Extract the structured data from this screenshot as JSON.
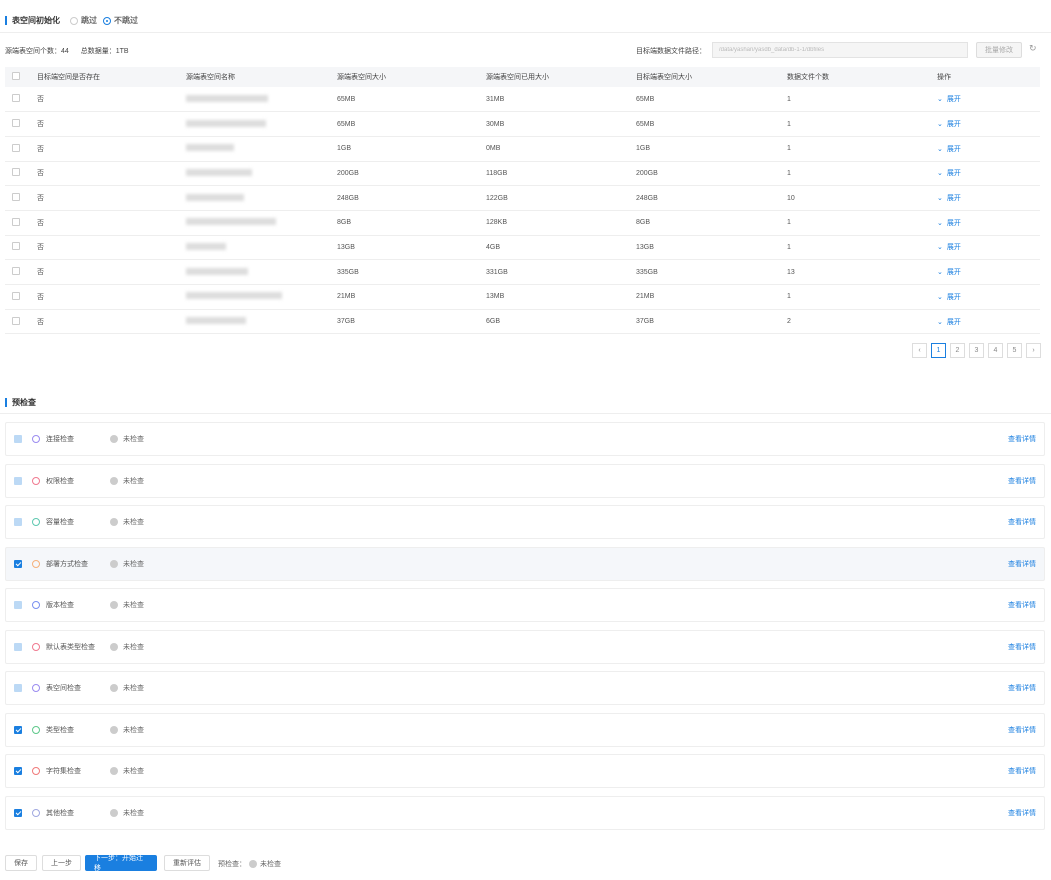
{
  "init": {
    "title": "表空间初始化",
    "opt_skip": "跳过",
    "opt_noskip": "不跳过"
  },
  "stats": {
    "count_label": "源端表空间个数：",
    "count": "44",
    "total_label": "总数据量：",
    "total": "1TB"
  },
  "path": {
    "label": "目标端数据文件路径：",
    "value": "/data/yashan/yasdb_data/db-1-1/dbfiles",
    "reset": "批量修改"
  },
  "table": {
    "headers": [
      "目标端空间是否存在",
      "源端表空间名称",
      "源端表空间大小",
      "源端表空间已用大小",
      "目标端表空间大小",
      "数据文件个数",
      "操作"
    ],
    "rows": [
      [
        "否",
        "65MB",
        "31MB",
        "65MB",
        "1"
      ],
      [
        "否",
        "65MB",
        "30MB",
        "65MB",
        "1"
      ],
      [
        "否",
        "1GB",
        "0MB",
        "1GB",
        "1"
      ],
      [
        "否",
        "200GB",
        "118GB",
        "200GB",
        "1"
      ],
      [
        "否",
        "248GB",
        "122GB",
        "248GB",
        "10"
      ],
      [
        "否",
        "8GB",
        "128KB",
        "8GB",
        "1"
      ],
      [
        "否",
        "13GB",
        "4GB",
        "13GB",
        "1"
      ],
      [
        "否",
        "335GB",
        "331GB",
        "335GB",
        "13"
      ],
      [
        "否",
        "21MB",
        "13MB",
        "21MB",
        "1"
      ],
      [
        "否",
        "37GB",
        "6GB",
        "37GB",
        "2"
      ]
    ],
    "action": "展开"
  },
  "pagination": {
    "pages": [
      "1",
      "2",
      "3",
      "4",
      "5"
    ],
    "current": "1"
  },
  "precheck": {
    "title": "预检查",
    "detail": "查看详情",
    "items": [
      {
        "name": "连接检查",
        "status": "未检查",
        "checked": false,
        "color": "#9b8cf0"
      },
      {
        "name": "权限检查",
        "status": "未检查",
        "checked": false,
        "color": "#f07a90"
      },
      {
        "name": "容量检查",
        "status": "未检查",
        "checked": false,
        "color": "#5ec8b0"
      },
      {
        "name": "部署方式检查",
        "status": "未检查",
        "checked": true,
        "color": "#f5b07a"
      },
      {
        "name": "版本检查",
        "status": "未检查",
        "checked": false,
        "color": "#7a90f0"
      },
      {
        "name": "默认表类型检查",
        "status": "未检查",
        "checked": false,
        "color": "#f07a90"
      },
      {
        "name": "表空间检查",
        "status": "未检查",
        "checked": false,
        "color": "#9b8cf0"
      },
      {
        "name": "类型检查",
        "status": "未检查",
        "checked": true,
        "color": "#5ec88a"
      },
      {
        "name": "字符集检查",
        "status": "未检查",
        "checked": true,
        "color": "#f07a7a"
      },
      {
        "name": "其他检查",
        "status": "未检查",
        "checked": true,
        "color": "#a0a8e0"
      }
    ]
  },
  "footer": {
    "save": "保存",
    "prev": "上一步",
    "next": "下一步：开始迁移",
    "reeval": "重新评估",
    "precheck_label": "预检查：",
    "precheck_status": "未检查"
  }
}
